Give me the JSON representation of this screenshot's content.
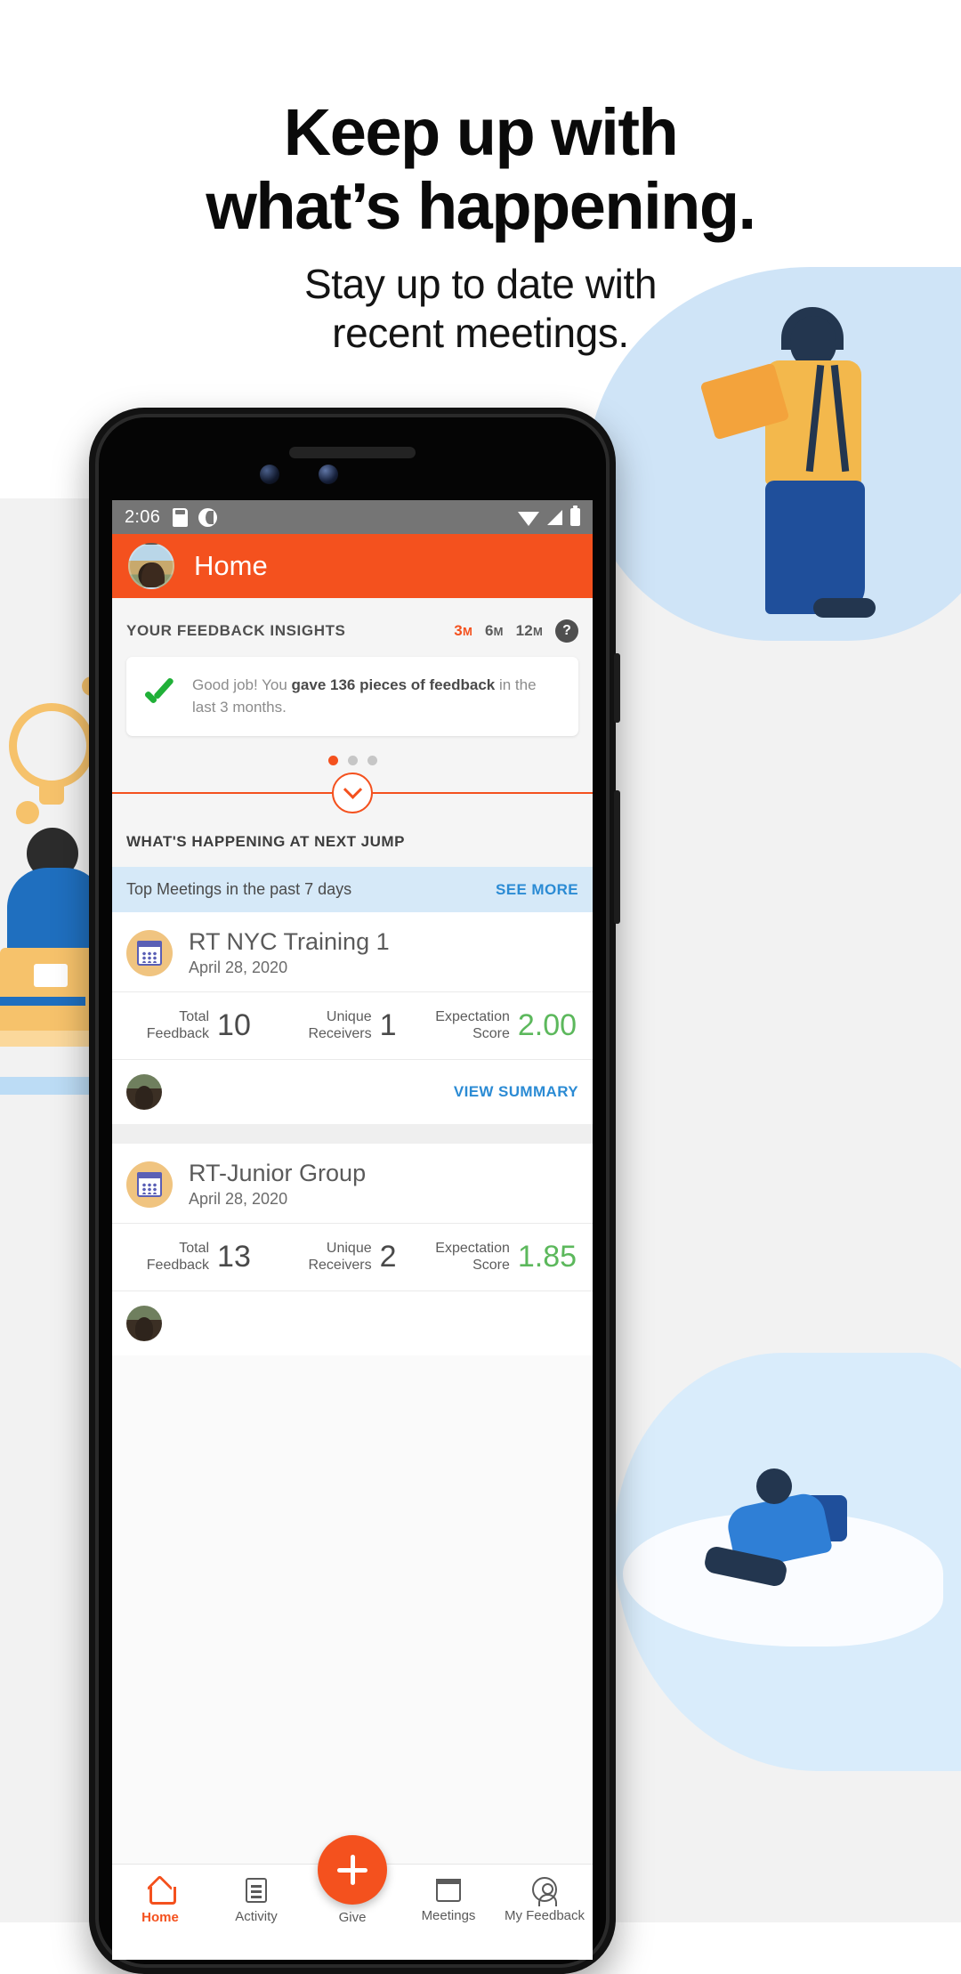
{
  "marketing": {
    "headline_line1": "Keep up with",
    "headline_line2": "what’s happening.",
    "subhead_line1": "Stay up to date with",
    "subhead_line2": "recent meetings."
  },
  "colors": {
    "brand_orange": "#f4511e",
    "link_blue": "#2b8bd4",
    "success_green": "#20b038",
    "score_green": "#5cb85c",
    "banner_blue": "#d6e9f8"
  },
  "phone": {
    "statusbar": {
      "time": "2:06",
      "icons_left": [
        "sd-card-icon",
        "clock-icon"
      ],
      "icons_right": [
        "wifi-icon",
        "signal-icon",
        "battery-icon"
      ]
    },
    "appbar": {
      "title": "Home",
      "avatar": "user-avatar"
    },
    "insights": {
      "title": "YOUR FEEDBACK INSIGHTS",
      "ranges": [
        {
          "label": "3",
          "unit": "M",
          "active": true
        },
        {
          "label": "6",
          "unit": "M",
          "active": false
        },
        {
          "label": "12",
          "unit": "M",
          "active": false
        }
      ],
      "help_label": "?",
      "card": {
        "icon": "green-check-icon",
        "text_before": "Good job! You ",
        "text_bold": "gave 136 pieces of feedback",
        "text_after": " in the last 3 months."
      },
      "pager": {
        "count": 3,
        "active_index": 0
      },
      "expand_icon": "chevron-down-icon"
    },
    "happening": {
      "section_title": "WHAT'S HAPPENING AT NEXT JUMP",
      "banner_label": "Top Meetings in the past 7 days",
      "see_more_label": "SEE MORE"
    },
    "meetings": [
      {
        "icon": "calendar-icon",
        "name": "RT NYC Training 1",
        "date": "April 28, 2020",
        "stats": [
          {
            "label_line1": "Total",
            "label_line2": "Feedback",
            "value": "10",
            "green": false
          },
          {
            "label_line1": "Unique",
            "label_line2": "Receivers",
            "value": "1",
            "green": false
          },
          {
            "label_line1": "Expectation",
            "label_line2": "Score",
            "value": "2.00",
            "green": true
          }
        ],
        "view_summary_label": "VIEW SUMMARY",
        "participant_avatar": "participant-avatar"
      },
      {
        "icon": "calendar-icon",
        "name": "RT-Junior Group",
        "date": "April 28, 2020",
        "stats": [
          {
            "label_line1": "Total",
            "label_line2": "Feedback",
            "value": "13",
            "green": false
          },
          {
            "label_line1": "Unique",
            "label_line2": "Receivers",
            "value": "2",
            "green": false
          },
          {
            "label_line1": "Expectation",
            "label_line2": "Score",
            "value": "1.85",
            "green": true
          }
        ]
      }
    ],
    "bottomnav": {
      "items": [
        {
          "label": "Home",
          "icon": "home-icon",
          "active": true
        },
        {
          "label": "Activity",
          "icon": "activity-icon",
          "active": false
        },
        {
          "label": "Give",
          "icon": "plus-icon",
          "active": false
        },
        {
          "label": "Meetings",
          "icon": "calendar-icon",
          "active": false
        },
        {
          "label": "My Feedback",
          "icon": "person-icon",
          "active": false
        }
      ],
      "fab_icon": "plus-icon"
    }
  }
}
